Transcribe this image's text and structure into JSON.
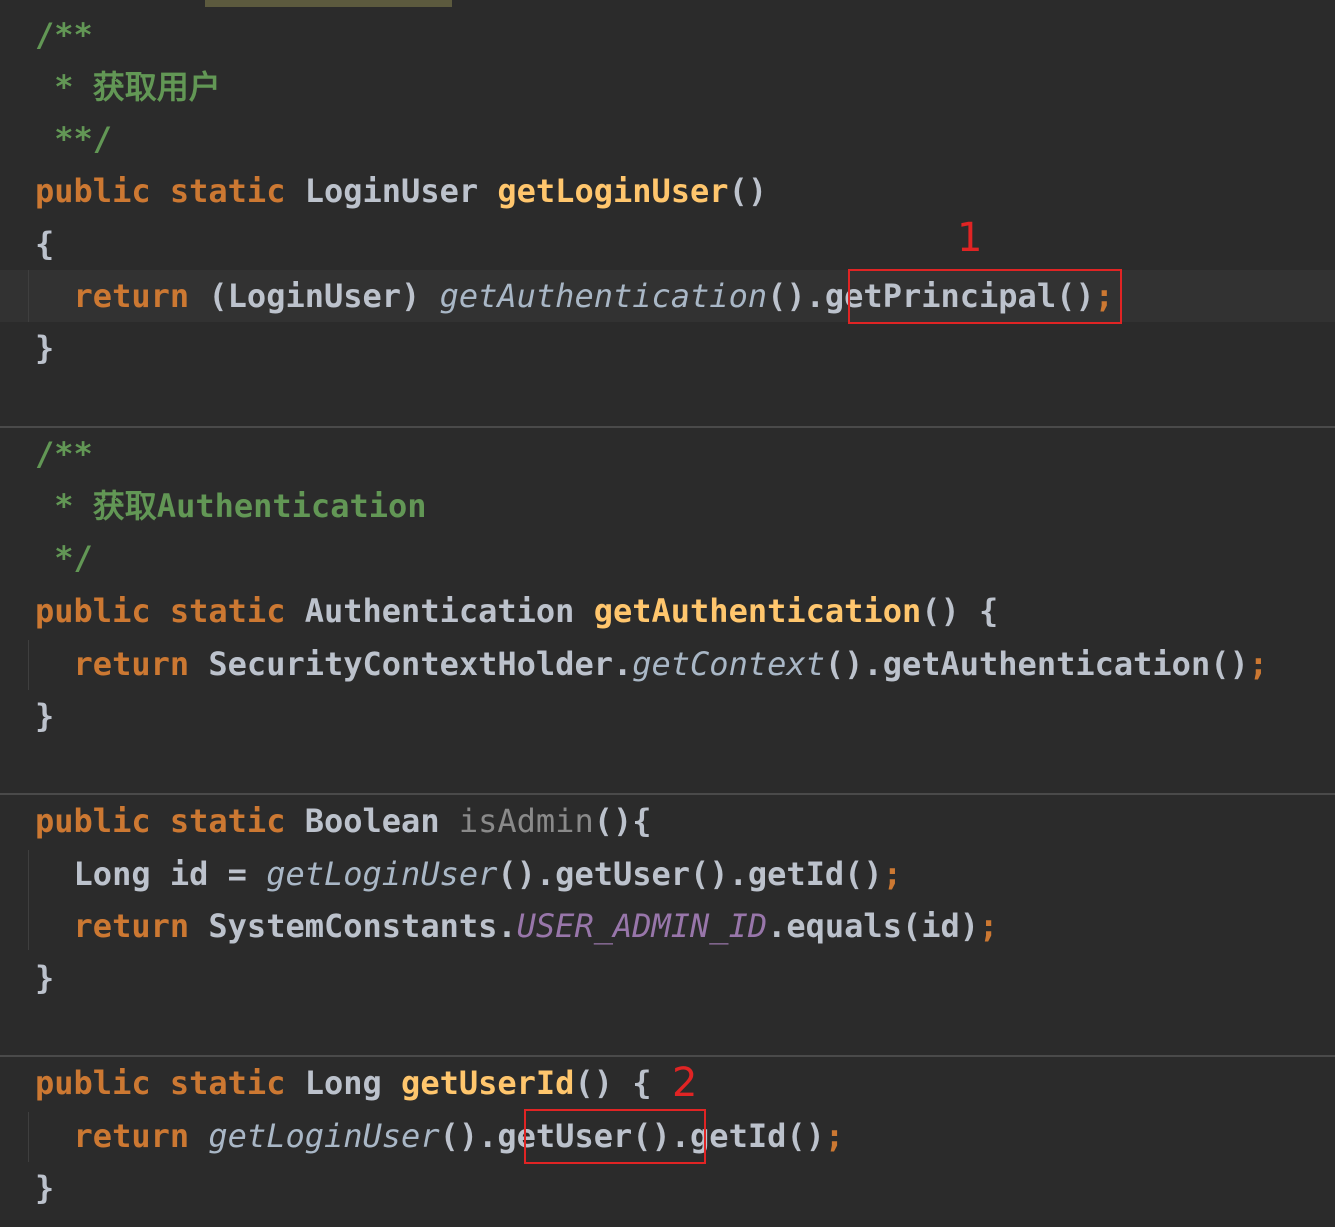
{
  "colors": {
    "background": "#2b2b2b",
    "keyword": "#cc7832",
    "method_declaration": "#ffc66d",
    "comment": "#629755",
    "constant": "#9876aa",
    "annotation_red": "#e02424"
  },
  "editor": {
    "doc1": {
      "open": "/**",
      "text": " * 获取用户",
      "close": " **/"
    },
    "method1": {
      "kw1": "public",
      "kw2": "static",
      "return_type": "LoginUser",
      "name": "getLoginUser",
      "params": "()",
      "open_brace": "{",
      "body_kw": "return",
      "cast": "(LoginUser)",
      "call": "getAuthentication",
      "call_parens": "().",
      "highlighted_call": "getPrincipal()",
      "semicolon": ";",
      "close_brace": "}"
    },
    "doc2": {
      "open": "/**",
      "text": " * 获取Authentication",
      "close": " */"
    },
    "method2": {
      "kw1": "public",
      "kw2": "static",
      "return_type": "Authentication",
      "name": "getAuthentication",
      "params": "() {",
      "body_kw": "return",
      "holder": "SecurityContextHolder.",
      "call": "getContext",
      "rest": "().getAuthentication()",
      "semicolon": ";",
      "close_brace": "}"
    },
    "method3": {
      "kw1": "public",
      "kw2": "static",
      "return_type": "Boolean",
      "name": "isAdmin",
      "params": "(){",
      "line1_decl": "Long id = ",
      "line1_call": "getLoginUser",
      "line1_rest": "().getUser().getId()",
      "line1_semicolon": ";",
      "line2_kw": "return",
      "line2_class": "SystemConstants.",
      "line2_const": "USER_ADMIN_ID",
      "line2_rest": ".equals(id)",
      "line2_semicolon": ";",
      "close_brace": "}"
    },
    "method4": {
      "kw1": "public",
      "kw2": "static",
      "return_type": "Long",
      "name": "getUserId",
      "params": "() {",
      "body_kw": "return",
      "call": "getLoginUser",
      "call_parens": "().",
      "highlighted_call": "getUser()",
      "rest": ".getId()",
      "semicolon": ";",
      "close_brace": "}"
    }
  },
  "annotations": {
    "label_1": "1",
    "label_2": "2"
  }
}
